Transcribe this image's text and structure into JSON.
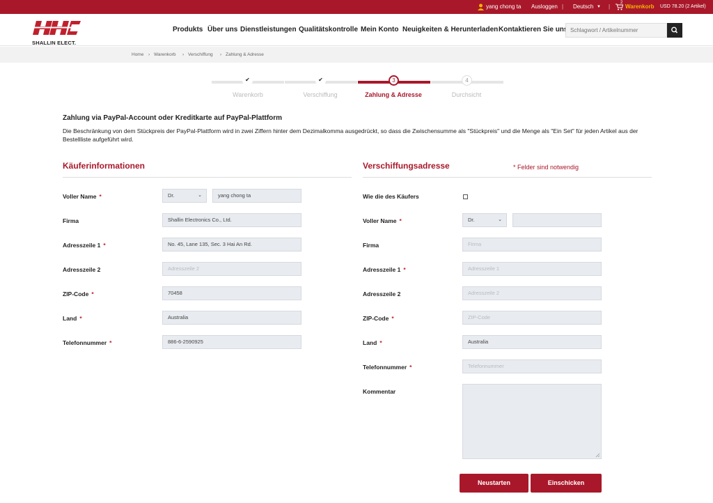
{
  "topbar": {
    "user": "yang chong ta",
    "logout": "Ausloggen",
    "language": "Deutsch",
    "cart_label": "Warenkorb",
    "cart_count": "2",
    "cart_total": "USD 78.20 (2 Artikel)"
  },
  "header": {
    "logo_text": "SHALLIN ELECT.",
    "nav": [
      "Produkts",
      "Über uns",
      "Dienstleistungen",
      "Qualitätskontrolle",
      "Mein Konto",
      "Neuigkeiten & Herunterladen",
      "Kontaktieren Sie uns"
    ],
    "search_placeholder": "Schlagwort / Artikelnummer"
  },
  "breadcrumb": [
    "Home",
    "Warenkorb",
    "Verschiffung",
    "Zahlung & Adresse"
  ],
  "steps": [
    {
      "num": "✔",
      "label": "Warenkorb"
    },
    {
      "num": "✔",
      "label": "Verschiffung"
    },
    {
      "num": "3",
      "label": "Zahlung & Adresse"
    },
    {
      "num": "4",
      "label": "Durchsicht"
    }
  ],
  "paypal": {
    "title": "Zahlung via PayPal-Account oder Kreditkarte auf PayPal-Plattform",
    "text": "Die Beschränkung von dem Stückpreis der PayPal-Plattform wird in zwei Ziffern hinter dem Dezimalkomma ausgedrückt, so dass die Zwischensumme als \"Stückpreis\" und die Menge als \"Ein Set\" für jeden Artikel aus der Bestellliste aufgeführt wird."
  },
  "buyer": {
    "title": "Käuferinformationen",
    "full_name_label": "Voller Name",
    "title_value": "Dr.",
    "name_value": "yang chong ta",
    "company_label": "Firma",
    "company_value": "Shallin Electronics Co., Ltd.",
    "addr1_label": "Adresszeile 1",
    "addr1_value": "No. 45, Lane 135, Sec. 3 Hai An Rd.",
    "addr2_label": "Adresszeile 2",
    "addr2_placeholder": "Adresszeile 2",
    "zip_label": "ZIP-Code",
    "zip_value": "70458",
    "country_label": "Land",
    "country_value": "Australia",
    "phone_label": "Telefonnummer",
    "phone_value": "886-6-2590925"
  },
  "shipping": {
    "title": "Verschiffungsadresse",
    "required_note": "* Felder sind notwendig",
    "same_label": "Wie die des Käufers",
    "full_name_label": "Voller Name",
    "title_value": "Dr.",
    "name_value": "",
    "company_label": "Firma",
    "company_placeholder": "Firma",
    "addr1_label": "Adresszeile 1",
    "addr1_placeholder": "Adresszeile 1",
    "addr2_label": "Adresszeile 2",
    "addr2_placeholder": "Adresszeile 2",
    "zip_label": "ZIP-Code",
    "zip_placeholder": "ZIP-Code",
    "country_label": "Land",
    "country_value": "Australia",
    "phone_label": "Telefonnummer",
    "phone_placeholder": "Telefonnummer",
    "comment_label": "Kommentar"
  },
  "buttons": {
    "reset": "Neustarten",
    "submit": "Einschicken"
  },
  "colors": {
    "brand": "#a8182a",
    "input_bg": "#e8ebef"
  }
}
